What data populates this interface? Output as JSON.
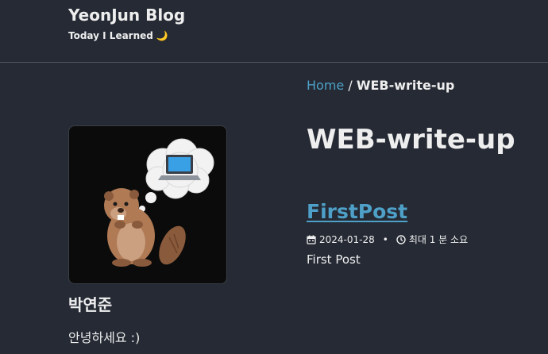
{
  "header": {
    "site_title": "YeonJun Blog",
    "site_subtitle": "Today I Learned",
    "subtitle_emoji": "🌙"
  },
  "sidebar": {
    "author_name": "박연준",
    "author_bio": "안녕하세요 :)",
    "avatar_icon": "beaver-with-laptop-thought-bubble"
  },
  "breadcrumb": {
    "home_label": "Home",
    "separator": "/",
    "current": "WEB-write-up"
  },
  "main": {
    "page_title": "WEB-write-up",
    "posts": [
      {
        "title": "FirstPost",
        "date": "2024-01-28",
        "separator": "•",
        "read_time": "최대 1 분 소요",
        "excerpt": "First Post"
      }
    ]
  },
  "colors": {
    "background": "#252a34",
    "text": "#eeeeee",
    "link": "#4ea0c8"
  }
}
